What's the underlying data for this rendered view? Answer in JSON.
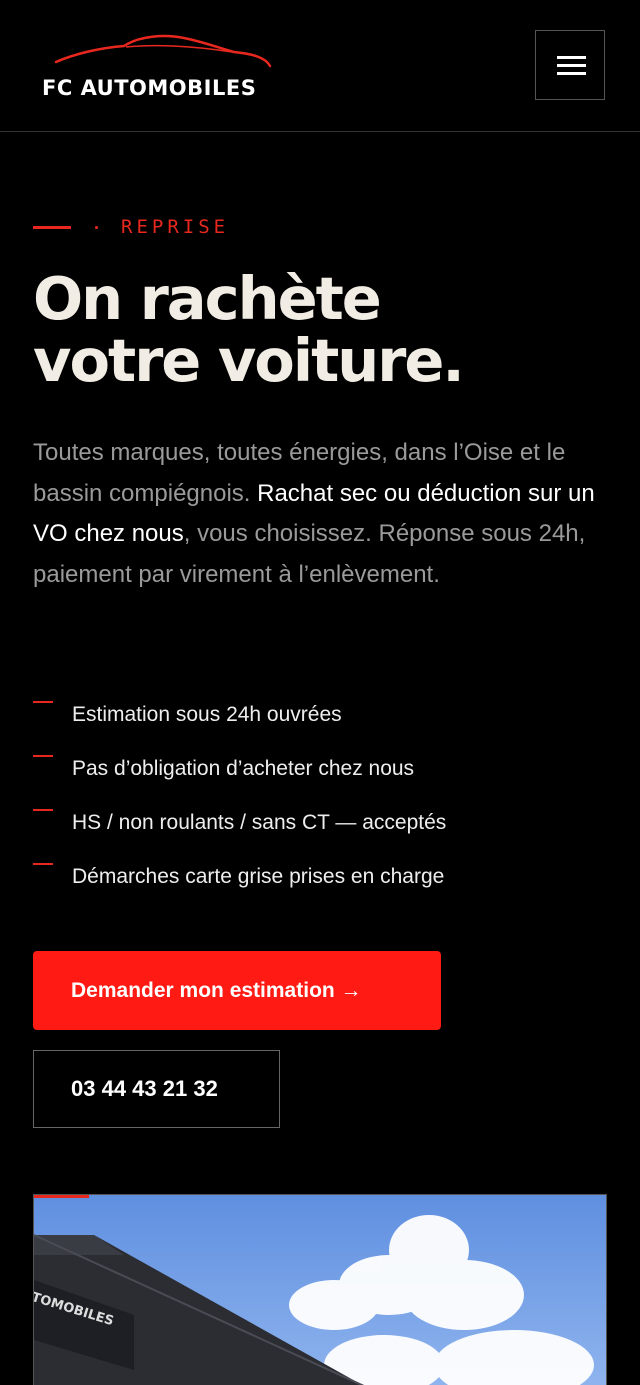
{
  "header": {
    "logo_text": "FC AUTOMOBILES",
    "menu_icon": "hamburger-icon"
  },
  "hero": {
    "eyebrow": "REPRISE",
    "title_line1": "On rachète",
    "title_line2": "votre voiture.",
    "intro_before": "Toutes marques, toutes énergies, dans l’Oise et le bassin compiégnois. ",
    "intro_strong": "Rachat sec ou déduction sur un VO chez nous",
    "intro_after": ", vous choisissez. Réponse sous 24h, paiement par virement à l’enlèvement."
  },
  "features": [
    "Estimation sous 24h ouvrées",
    "Pas d’obligation d’acheter chez nous",
    "HS / non roulants / sans CT — acceptés",
    "Démarches carte grise prises en charge"
  ],
  "cta": {
    "primary_label": "Demander mon estimation →",
    "phone_label": "03 44 43 21 32"
  },
  "photo": {
    "sign_text": "TOMOBILES"
  },
  "colors": {
    "accent": "#e8281e",
    "button": "#ff1a14",
    "background": "#000000",
    "title": "#f1ede4"
  }
}
